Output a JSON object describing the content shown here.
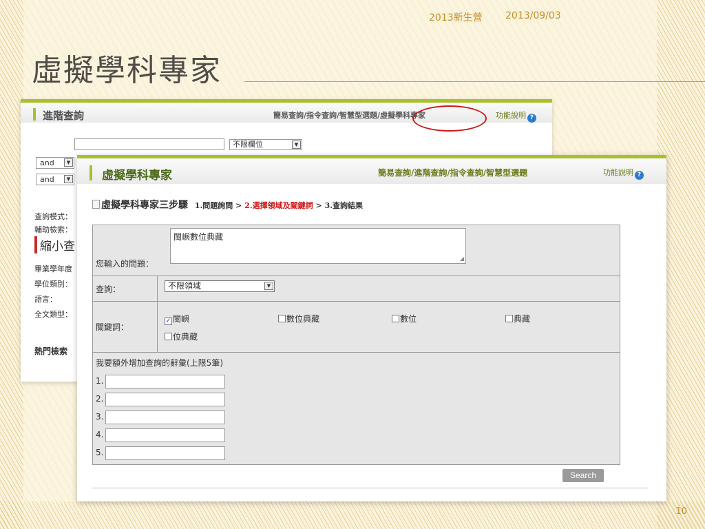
{
  "slide": {
    "header_left": "2013新生營",
    "header_right": "2013/09/03",
    "title": "虛擬學科專家",
    "page_number": "10"
  },
  "back_panel": {
    "title": "進階查詢",
    "nav_links": "簡易查詢/指令查詢/智慧型選題/虛擬學科專家",
    "help_label": "功能說明",
    "field_select": "不限欄位",
    "bool_ops": [
      "and",
      "and"
    ],
    "labels": [
      "查詢模式：",
      "輔助檢索：",
      "畢業學年度",
      "學位類別：",
      "語言：",
      "全文類型："
    ],
    "narrow_title": "縮小查",
    "hot_search": "熱門檢索"
  },
  "front_panel": {
    "title": "虛擬學科專家",
    "nav_links": "簡易查詢/進階查詢/指令查詢/智慧型選題",
    "help_label": "功能說明",
    "steps_title": "虛擬學科專家三步驟",
    "step1": "1.問題詢問",
    "separator": ">",
    "step2": "2.選擇領域及關鍵詞",
    "step3": "3.查詢結果",
    "question_label": "您輸入的問題：",
    "question_value": "閩嶼數位典藏",
    "query_label": "查詢：",
    "domain_select": "不限領域",
    "keyword_label": "關鍵詞：",
    "keywords": [
      {
        "label": "閩嶼",
        "checked": true
      },
      {
        "label": "數位典藏",
        "checked": false
      },
      {
        "label": "數位",
        "checked": false
      },
      {
        "label": "典藏",
        "checked": false
      },
      {
        "label": "位典藏",
        "checked": false
      }
    ],
    "extra_title": "我要額外增加查詢的辭彙(上限5筆)",
    "extra_items": [
      "1.",
      "2.",
      "3.",
      "4.",
      "5."
    ],
    "search_button": "Search"
  },
  "colors": {
    "accent_green": "#a7c02c",
    "highlight_red": "#d01818",
    "header_gold": "#c88f2a"
  }
}
